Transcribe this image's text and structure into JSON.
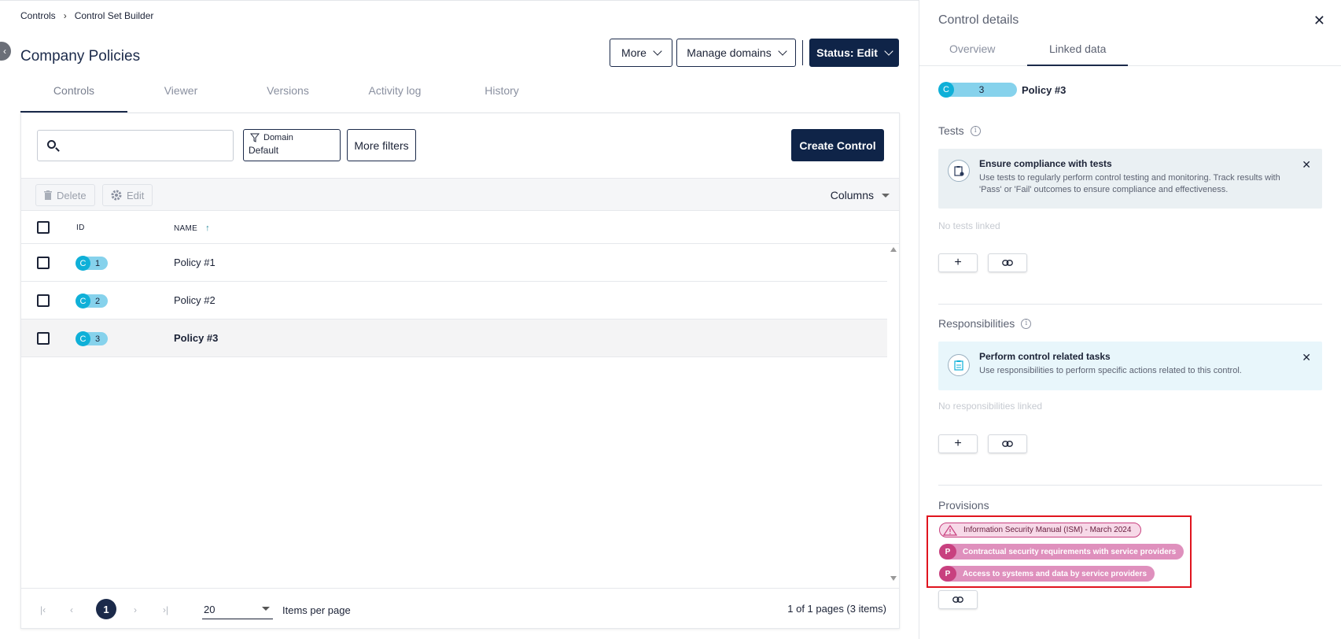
{
  "breadcrumb": {
    "root": "Controls",
    "current": "Control Set Builder"
  },
  "page": {
    "title": "Company Policies"
  },
  "header_buttons": {
    "more": "More",
    "manage_domains": "Manage domains",
    "status": "Status: Edit"
  },
  "tabs": [
    {
      "label": "Controls",
      "active": true
    },
    {
      "label": "Viewer"
    },
    {
      "label": "Versions"
    },
    {
      "label": "Activity log"
    },
    {
      "label": "History"
    }
  ],
  "search": {
    "value": "",
    "placeholder": ""
  },
  "filters": {
    "domain_label": "Domain",
    "domain_value": "Default",
    "more_filters": "More filters"
  },
  "create_button": "Create Control",
  "toolbar": {
    "delete": "Delete",
    "edit": "Edit",
    "columns": "Columns"
  },
  "table": {
    "headers": {
      "id": "ID",
      "name": "NAME"
    },
    "rows": [
      {
        "prefix": "C",
        "id": "1",
        "name": "Policy #1",
        "selected": false
      },
      {
        "prefix": "C",
        "id": "2",
        "name": "Policy #2",
        "selected": false
      },
      {
        "prefix": "C",
        "id": "3",
        "name": "Policy #3",
        "selected": true
      }
    ]
  },
  "pagination": {
    "current_page": "1",
    "per_page": "20",
    "per_page_label": "Items per page",
    "info": "1 of 1 pages (3 items)"
  },
  "side_panel": {
    "title": "Control details",
    "tabs": [
      {
        "label": "Overview"
      },
      {
        "label": "Linked data",
        "active": true
      }
    ],
    "control": {
      "prefix": "C",
      "id": "3",
      "name": "Policy #3"
    },
    "tests": {
      "title": "Tests",
      "notice_title": "Ensure compliance with tests",
      "notice_text": "Use tests to regularly perform control testing and monitoring. Track results with 'Pass' or 'Fail' outcomes to ensure compliance and effectiveness.",
      "empty": "No tests linked"
    },
    "responsibilities": {
      "title": "Responsibilities",
      "notice_title": "Perform control related tasks",
      "notice_text": "Use responsibilities to perform specific actions related to this control.",
      "empty": "No responsibilities linked"
    },
    "provisions": {
      "title": "Provisions",
      "warning_chip": "Information Security Manual (ISM) - March 2024",
      "items": [
        {
          "prefix": "P",
          "label": "Contractual security requirements with service providers"
        },
        {
          "prefix": "P",
          "label": "Access to systems and data by service providers"
        }
      ]
    }
  },
  "colors": {
    "navy": "#0f2448",
    "badge_cyan": "#0fb0d8",
    "badge_light": "#86d2ec",
    "provision_pink": "#df90bd",
    "highlight_red": "#e0141e"
  },
  "icons": [
    "chevron-right-icon",
    "chevron-down-icon",
    "search-icon",
    "filter-icon",
    "trash-icon",
    "gear-icon",
    "sort-up-icon",
    "close-icon",
    "info-icon",
    "clipboard-icon",
    "plus-icon",
    "link-icon",
    "warning-icon"
  ]
}
